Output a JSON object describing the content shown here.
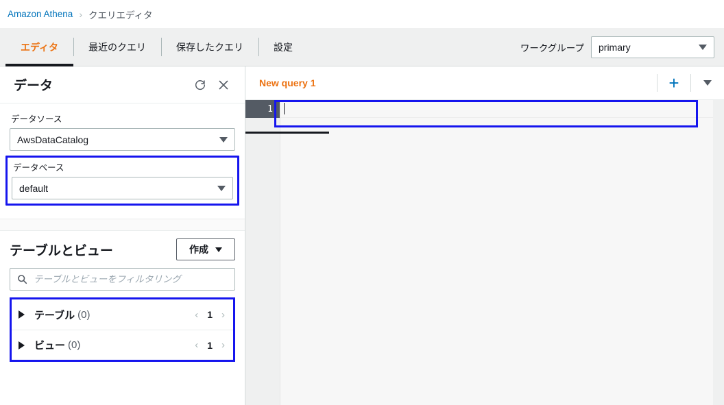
{
  "breadcrumb": {
    "root": "Amazon Athena",
    "separator": "›",
    "current": "クエリエディタ"
  },
  "nav": {
    "tabs": [
      {
        "label": "エディタ",
        "active": true
      },
      {
        "label": "最近のクエリ",
        "active": false
      },
      {
        "label": "保存したクエリ",
        "active": false
      },
      {
        "label": "設定",
        "active": false
      }
    ],
    "workgroup_label": "ワークグループ",
    "workgroup_value": "primary"
  },
  "data_panel": {
    "title": "データ",
    "refresh_icon": "refresh-icon",
    "close_icon": "close-icon",
    "datasource_label": "データソース",
    "datasource_value": "AwsDataCatalog",
    "database_label": "データベース",
    "database_value": "default",
    "tables_title": "テーブルとビュー",
    "create_label": "作成",
    "filter_placeholder": "テーブルとビューをフィルタリング",
    "filter_value": "",
    "search_icon": "search-icon",
    "rows": [
      {
        "name": "テーブル",
        "count": "(0)",
        "page": "1"
      },
      {
        "name": "ビュー",
        "count": "(0)",
        "page": "1"
      }
    ],
    "prev_icon": "‹",
    "next_icon": "›"
  },
  "query": {
    "tab_label": "New query 1",
    "add_label": "+",
    "menu_icon": "chevron-down-icon",
    "line_number": "1",
    "code": ""
  },
  "colors": {
    "accent_orange": "#ec7211",
    "link_blue": "#0073bb",
    "highlight_blue": "#1515ee",
    "dark_text": "#16191f",
    "gutter_gray": "#545b64"
  }
}
